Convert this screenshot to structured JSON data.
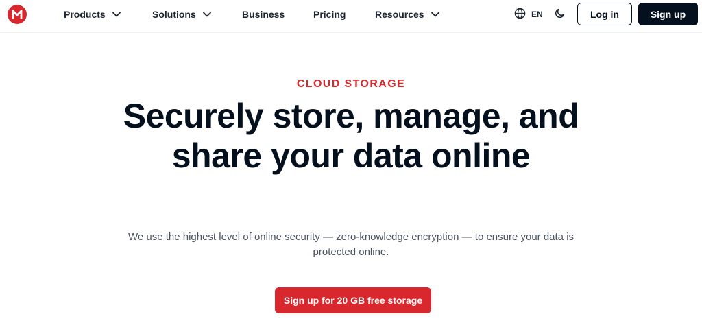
{
  "brand": {
    "logo_letter": "M",
    "logo_icon": "mega-logo-icon",
    "accent_color": "#d9272e",
    "dark_color": "#04101e"
  },
  "nav": {
    "products": "Products",
    "solutions": "Solutions",
    "business": "Business",
    "pricing": "Pricing",
    "resources": "Resources",
    "dropdown_icon": "chevron-down-icon"
  },
  "header_actions": {
    "language": "EN",
    "language_icon": "globe-icon",
    "theme_icon": "moon-icon",
    "login_label": "Log in",
    "signup_label": "Sign up"
  },
  "hero": {
    "eyebrow": "CLOUD STORAGE",
    "headline": "Securely store, manage, and share your data online",
    "subtext": "We use the highest level of online security — zero-knowledge encryption — to ensure your data is protected online.",
    "cta_label": "Sign up for 20 GB free storage"
  }
}
